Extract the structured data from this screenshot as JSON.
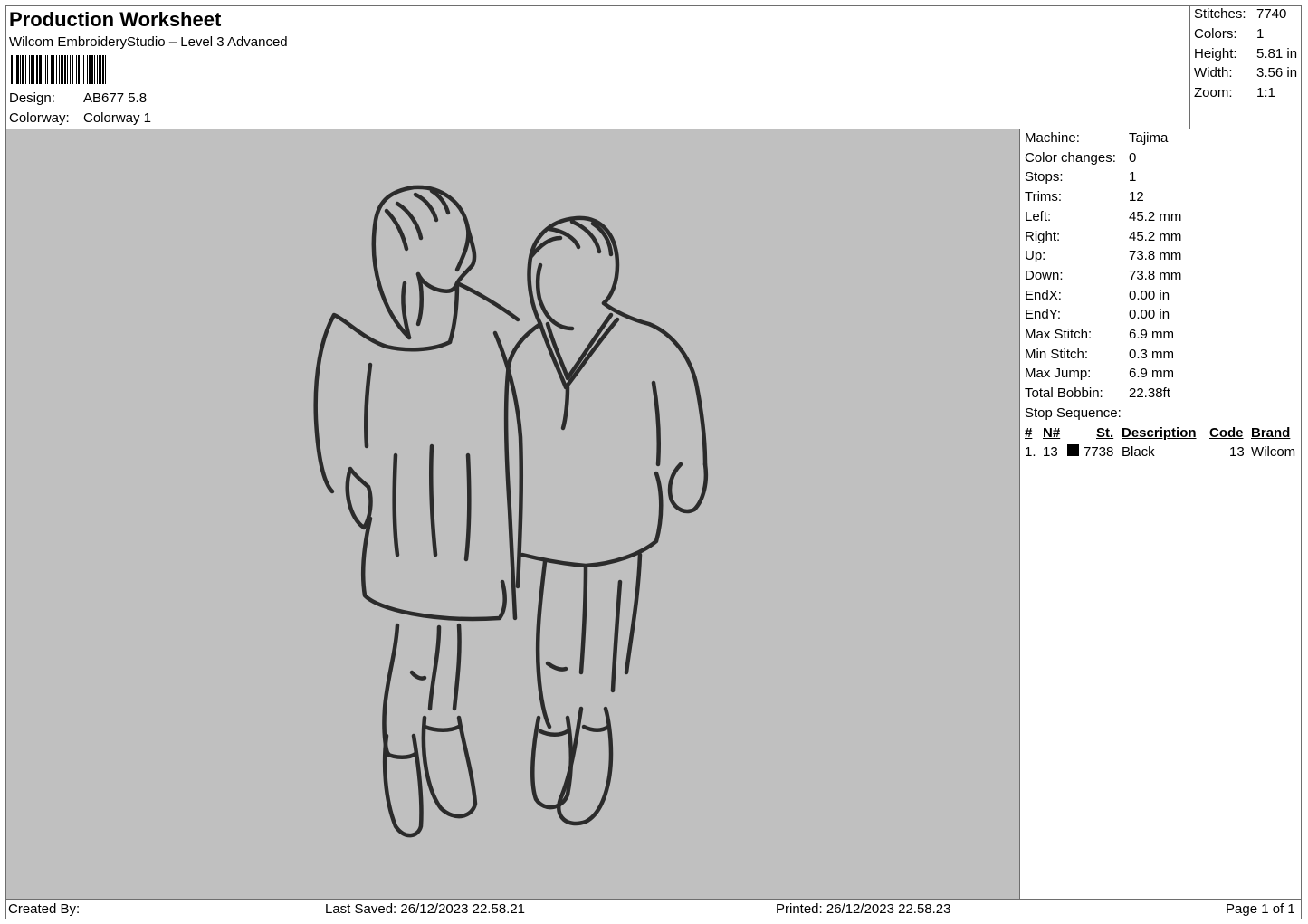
{
  "header": {
    "title": "Production Worksheet",
    "subtitle": "Wilcom EmbroideryStudio – Level 3 Advanced",
    "design_label": "Design:",
    "design_value": "AB677 5.8",
    "colorway_label": "Colorway:",
    "colorway_value": "Colorway 1"
  },
  "summary": {
    "stitches_label": "Stitches:",
    "stitches_value": "7740",
    "colors_label": "Colors:",
    "colors_value": "1",
    "height_label": "Height:",
    "height_value": "5.81 in",
    "width_label": "Width:",
    "width_value": "3.56 in",
    "zoom_label": "Zoom:",
    "zoom_value": "1:1"
  },
  "machine_info": [
    {
      "label": "Machine:",
      "value": "Tajima"
    },
    {
      "label": "Color changes:",
      "value": "0"
    },
    {
      "label": "Stops:",
      "value": "1"
    },
    {
      "label": "Trims:",
      "value": "12"
    },
    {
      "label": "Left:",
      "value": "45.2 mm"
    },
    {
      "label": "Right:",
      "value": "45.2 mm"
    },
    {
      "label": "Up:",
      "value": "73.8 mm"
    },
    {
      "label": "Down:",
      "value": "73.8 mm"
    },
    {
      "label": "EndX:",
      "value": "0.00 in"
    },
    {
      "label": "EndY:",
      "value": "0.00 in"
    },
    {
      "label": "Max Stitch:",
      "value": "6.9 mm"
    },
    {
      "label": "Min Stitch:",
      "value": "0.3 mm"
    },
    {
      "label": "Max Jump:",
      "value": "6.9 mm"
    },
    {
      "label": "Total Bobbin:",
      "value": "22.38ft"
    }
  ],
  "stop_sequence": {
    "label": "Stop Sequence:",
    "columns": [
      "#",
      "N#",
      "St.",
      "Description",
      "Code",
      "Brand"
    ],
    "rows": [
      {
        "index": "1.",
        "needle": "13",
        "swatch_color": "#000000",
        "stitches": "7738",
        "description": "Black",
        "code": "13",
        "brand": "Wilcom"
      }
    ]
  },
  "preview": {
    "background_color": "#c0c0c0",
    "thread_color": "#2b2b2b"
  },
  "footer": {
    "created_by": "Created By:",
    "last_saved": "Last Saved: 26/12/2023 22.58.21",
    "printed": "Printed: 26/12/2023 22.58.23",
    "page": "Page 1 of 1"
  }
}
